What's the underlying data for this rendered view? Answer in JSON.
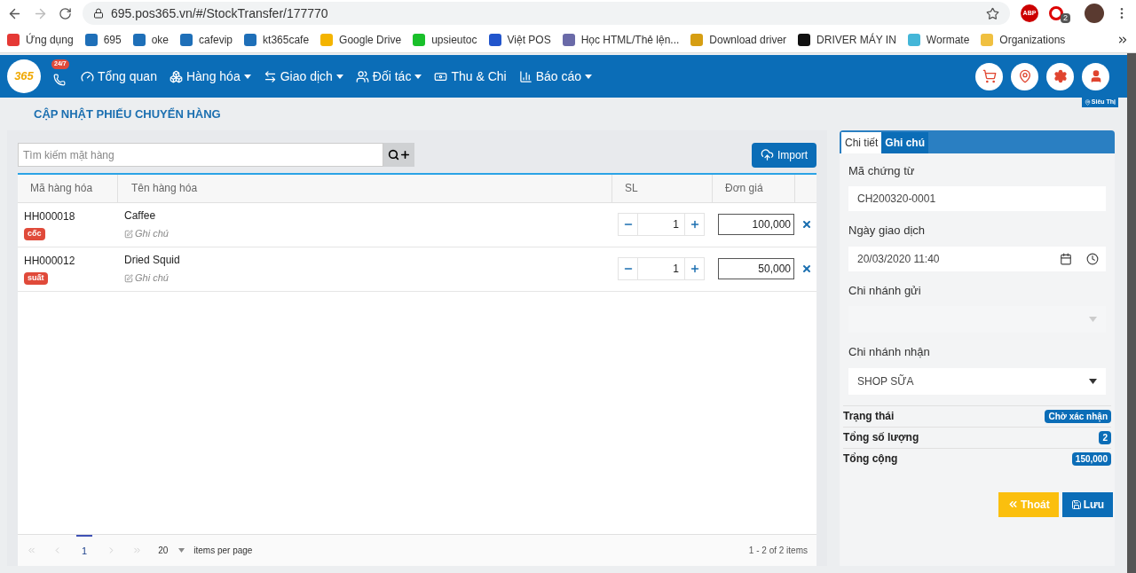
{
  "browser": {
    "url": "695.pos365.vn/#/StockTransfer/177770",
    "extension_badge": "2",
    "adblock_label": "ABP",
    "bookmarks": [
      {
        "label": "Ứng dụng",
        "color": "#e53935"
      },
      {
        "label": "695",
        "color": "#1e6fb8"
      },
      {
        "label": "oke",
        "color": "#1e6fb8"
      },
      {
        "label": "cafevip",
        "color": "#1e6fb8"
      },
      {
        "label": "kt365cafe",
        "color": "#1e6fb8"
      },
      {
        "label": "Google Drive",
        "color": "#f4b400"
      },
      {
        "label": "upsieutoc",
        "color": "#19c02a"
      },
      {
        "label": "Việt POS",
        "color": "#2255cc"
      },
      {
        "label": "Học HTML/Thẻ lện...",
        "color": "#6a6aa8"
      },
      {
        "label": "Download driver",
        "color": "#d69e12"
      },
      {
        "label": "DRIVER MÁY IN",
        "color": "#111111"
      },
      {
        "label": "Wormate",
        "color": "#44b6d8"
      },
      {
        "label": "Organizations",
        "color": "#f0c040"
      }
    ]
  },
  "app": {
    "logo": "365",
    "hotline_badge": "24/7",
    "nav": [
      {
        "label": "Tổng quan",
        "dropdown": false
      },
      {
        "label": "Hàng hóa",
        "dropdown": true
      },
      {
        "label": "Giao dịch",
        "dropdown": true
      },
      {
        "label": "Đối tác",
        "dropdown": true
      },
      {
        "label": "Thu & Chi",
        "dropdown": false
      },
      {
        "label": "Báo cáo",
        "dropdown": true
      }
    ],
    "store_badge": "Siêu Thị"
  },
  "page": {
    "title": "CẬP NHẬT PHIẾU CHUYỂN HÀNG"
  },
  "search": {
    "placeholder": "Tìm kiếm mặt hàng"
  },
  "import_button": "Import",
  "table": {
    "columns": [
      "Mã hàng hóa",
      "Tên hàng hóa",
      "SL",
      "Đơn giá"
    ],
    "rows": [
      {
        "code": "HH000018",
        "unit": "cốc",
        "name": "Caffee",
        "note": "Ghi chú",
        "qty": "1",
        "price": "100,000"
      },
      {
        "code": "HH000012",
        "unit": "suất",
        "name": "Dried Squid",
        "note": "Ghi chú",
        "qty": "1",
        "price": "50,000"
      }
    ]
  },
  "pagination": {
    "pages": [
      {
        "label": "1",
        "selected": true
      }
    ],
    "page_size": "20",
    "page_size_label": "items per page",
    "summary": "1 - 2 of 2 items"
  },
  "side": {
    "tabs": [
      {
        "label": "Chi tiết",
        "selected": true
      },
      {
        "label": "Ghi chú",
        "selected": false
      }
    ],
    "fields": [
      {
        "label": "Mã chứng từ",
        "value": "CH200320-0001",
        "kind": "text"
      },
      {
        "label": "Ngày giao dịch",
        "value": "20/03/2020 11:40",
        "kind": "datetime"
      },
      {
        "label": "Chi nhánh gửi",
        "kind": "select",
        "disabled": true
      },
      {
        "label": "Chi nhánh nhận",
        "value": "SHOP SỮA",
        "kind": "select",
        "disabled": false
      }
    ],
    "summary": [
      {
        "label": "Trạng thái",
        "value": "Chờ xác nhận"
      },
      {
        "label": "Tổng số lượng",
        "value": "2"
      },
      {
        "label": "Tổng cộng",
        "value": "150,000"
      }
    ],
    "buttons": [
      {
        "label": "Thoát",
        "kind": "exit"
      },
      {
        "label": "Lưu",
        "kind": "save"
      }
    ]
  }
}
